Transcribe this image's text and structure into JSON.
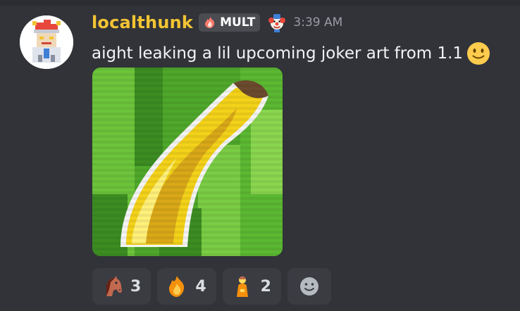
{
  "message": {
    "username": "localthunk",
    "guild_tag": {
      "label": "MULT",
      "icon": "fire-icon"
    },
    "role_icon": "clown-icon",
    "timestamp": "3:39 AM",
    "text": "aight leaking a lil upcoming joker art from 1.1",
    "inline_emoji": "slightly-smiling-face-icon",
    "attachment": {
      "type": "image",
      "subject": "pixel-art-banana-joker-icon"
    }
  },
  "reactions": [
    {
      "icon": "horse-face-icon",
      "count": "3"
    },
    {
      "icon": "fire-icon",
      "count": "4"
    },
    {
      "icon": "person-pouting-icon",
      "count": "2"
    }
  ],
  "add_reaction": {
    "icon": "smiley-add-reaction-icon"
  },
  "colors": {
    "background": "#313338",
    "username": "#f2c433",
    "text": "#f2f3f5",
    "timestamp": "#9b9ca3",
    "reaction_bg": "#3a3c42"
  }
}
